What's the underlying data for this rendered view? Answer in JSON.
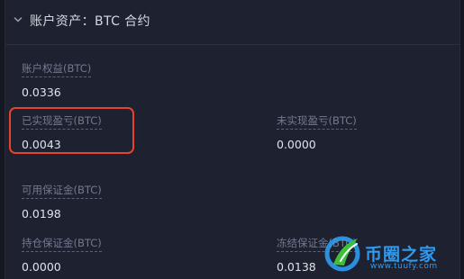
{
  "header": {
    "title": "账户资产：BTC 合约",
    "toggle_icon": "chevron-down-icon"
  },
  "fields": {
    "equity": {
      "label": "账户权益(BTC)",
      "value": "0.0336"
    },
    "realized_pnl": {
      "label": "已实现盈亏(BTC)",
      "value": "0.0043"
    },
    "unrealized_pnl": {
      "label": "未实现盈亏(BTC)",
      "value": "0.0000"
    },
    "available_margin": {
      "label": "可用保证金(BTC)",
      "value": "0.0198"
    },
    "position_margin": {
      "label": "持仓保证金(BTC)",
      "value": "0.0000"
    },
    "frozen_margin": {
      "label": "冻结保证金(BTC)",
      "value": "0.0138"
    }
  },
  "watermark": {
    "brand": "币圈之家",
    "url": "www.tuufy.com"
  },
  "colors": {
    "background": "#1d2130",
    "highlight": "#e8432a",
    "watermark_blue": "#2f9bf0",
    "watermark_green": "#3fbf3a"
  }
}
